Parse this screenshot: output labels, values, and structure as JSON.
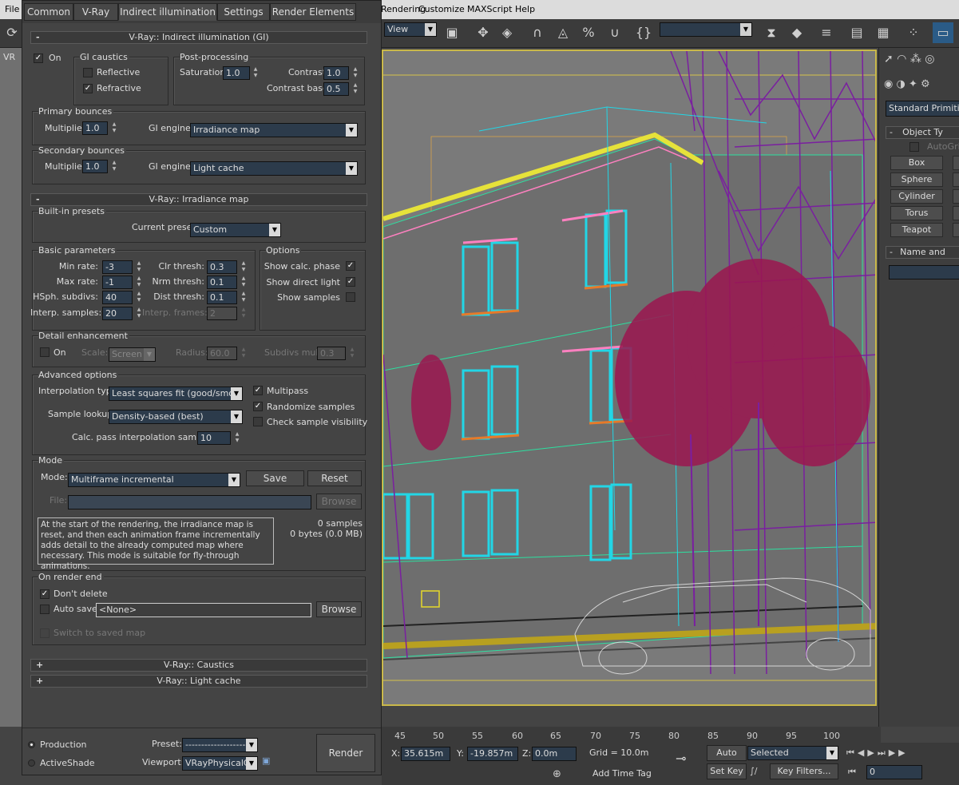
{
  "menubar": {
    "items": [
      "File",
      "Rendering",
      "Customize",
      "MAXScript",
      "Help"
    ]
  },
  "toolbar": {
    "view_dropdown": "View",
    "selection_set": ""
  },
  "dialog": {
    "tabs": [
      "Common",
      "V-Ray",
      "Indirect illumination",
      "Settings",
      "Render Elements"
    ],
    "gi_rollout": {
      "title": "V-Ray:: Indirect illumination (GI)",
      "on_label": "On",
      "gi_caustics": {
        "title": "GI caustics",
        "reflective": "Reflective",
        "refractive": "Refractive"
      },
      "post": {
        "title": "Post-processing",
        "saturation_label": "Saturation:",
        "saturation": "1.0",
        "contrast_label": "Contrast:",
        "contrast": "1.0",
        "contrast_base_label": "Contrast base:",
        "contrast_base": "0.5"
      },
      "primary": {
        "title": "Primary bounces",
        "multiplier_label": "Multiplier:",
        "multiplier": "1.0",
        "engine_label": "GI engine:",
        "engine": "Irradiance map"
      },
      "secondary": {
        "title": "Secondary bounces",
        "multiplier_label": "Multiplier:",
        "multiplier": "1.0",
        "engine_label": "GI engine:",
        "engine": "Light cache"
      }
    },
    "irr_rollout": {
      "title": "V-Ray:: Irradiance map",
      "presets": {
        "title": "Built-in presets",
        "current_label": "Current preset:",
        "current": "Custom"
      },
      "basic": {
        "title": "Basic parameters",
        "min_rate_label": "Min rate:",
        "min_rate": "-3",
        "max_rate_label": "Max rate:",
        "max_rate": "-1",
        "hsph_label": "HSph. subdivs:",
        "hsph": "40",
        "interp_samples_label": "Interp. samples:",
        "interp_samples": "20",
        "clr_label": "Clr thresh:",
        "clr": "0.3",
        "nrm_label": "Nrm thresh:",
        "nrm": "0.1",
        "dist_label": "Dist thresh:",
        "dist": "0.1",
        "frames_label": "Interp. frames:",
        "frames": "2"
      },
      "options": {
        "title": "Options",
        "show_calc": "Show calc. phase",
        "show_direct": "Show direct light",
        "show_samples": "Show samples"
      },
      "detail": {
        "title": "Detail enhancement",
        "on_label": "On",
        "scale_label": "Scale:",
        "scale": "Screen",
        "radius_label": "Radius:",
        "radius": "60.0",
        "subdivs_label": "Subdivs mult.",
        "subdivs": "0.3"
      },
      "advanced": {
        "title": "Advanced options",
        "interp_type_label": "Interpolation type:",
        "interp_type": "Least squares fit (good/smooth",
        "lookup_label": "Sample lookup:",
        "lookup": "Density-based (best)",
        "calc_pass_label": "Calc. pass interpolation samples:",
        "calc_pass": "10",
        "multipass": "Multipass",
        "randomize": "Randomize samples",
        "check_vis": "Check sample visibility"
      },
      "mode": {
        "title": "Mode",
        "mode_label": "Mode:",
        "mode_value": "Multiframe incremental",
        "save": "Save",
        "reset": "Reset",
        "file_label": "File:",
        "file_value": "",
        "browse": "Browse",
        "description": "At the start of the rendering, the irradiance map is reset, and then each animation frame incrementally adds detail to the already computed map where necessary. This mode is suitable for fly-through animations.",
        "samples": "0 samples",
        "bytes": "0 bytes (0.0 MB)"
      },
      "render_end": {
        "title": "On render end",
        "dont_delete": "Don't delete",
        "auto_save": "Auto save:",
        "auto_save_value": "<None>",
        "browse": "Browse",
        "switch": "Switch to saved map"
      }
    },
    "caustics_rollout": "V-Ray:: Caustics",
    "lightcache_rollout": "V-Ray:: Light cache",
    "bottom": {
      "production": "Production",
      "activeshade": "ActiveShade",
      "preset_label": "Preset:",
      "preset": "--------------------",
      "viewport_label": "Viewport:",
      "viewport": "VRayPhysicalCa",
      "render": "Render"
    }
  },
  "command_panel": {
    "category": "Standard Primitives",
    "object_type": "Object Ty",
    "autogrid": "AutoGri",
    "buttons": [
      "Box",
      "Sphere",
      "Cylinder",
      "Torus",
      "Teapot"
    ],
    "name_color": "Name and"
  },
  "timeline": {
    "ticks": [
      "45",
      "50",
      "55",
      "60",
      "65",
      "70",
      "75",
      "80",
      "85",
      "90",
      "95",
      "100"
    ]
  },
  "status": {
    "x_label": "X:",
    "x": "35.615m",
    "y_label": "Y:",
    "y": "-19.857m",
    "z_label": "Z:",
    "z": "0.0m",
    "grid": "Grid = 10.0m",
    "add_time_tag": "Add Time Tag",
    "auto_key": "Auto Key",
    "set_key": "Set Key",
    "selected": "Selected",
    "key_filters": "Key Filters...",
    "frame": "0"
  },
  "viewport_label": "VR",
  "colors": {
    "accent_blue": "#2c3b4b",
    "viewport_border": "#c9b84a",
    "purple": "#7a1fa0",
    "cyan": "#22d6e6",
    "tree": "#9b1650"
  }
}
